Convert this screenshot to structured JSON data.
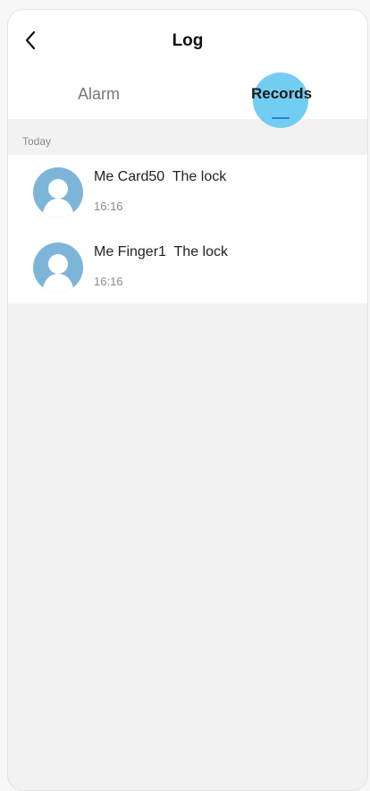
{
  "header": {
    "title": "Log",
    "back_icon": "chevron-left-icon"
  },
  "tabs": [
    {
      "label": "Alarm",
      "active": false
    },
    {
      "label": "Records",
      "active": true
    }
  ],
  "colors": {
    "accent": "#2a7fe0",
    "tap_highlight": "#72cdf2",
    "avatar_bg": "#7db5d9",
    "page_bg": "#f2f2f2"
  },
  "records": {
    "section_label": "Today",
    "items": [
      {
        "text": "Me Card50  The lock",
        "time": "16:16",
        "icon": "user-avatar-icon"
      },
      {
        "text": "Me Finger1  The lock",
        "time": "16:16",
        "icon": "user-avatar-icon"
      }
    ]
  }
}
